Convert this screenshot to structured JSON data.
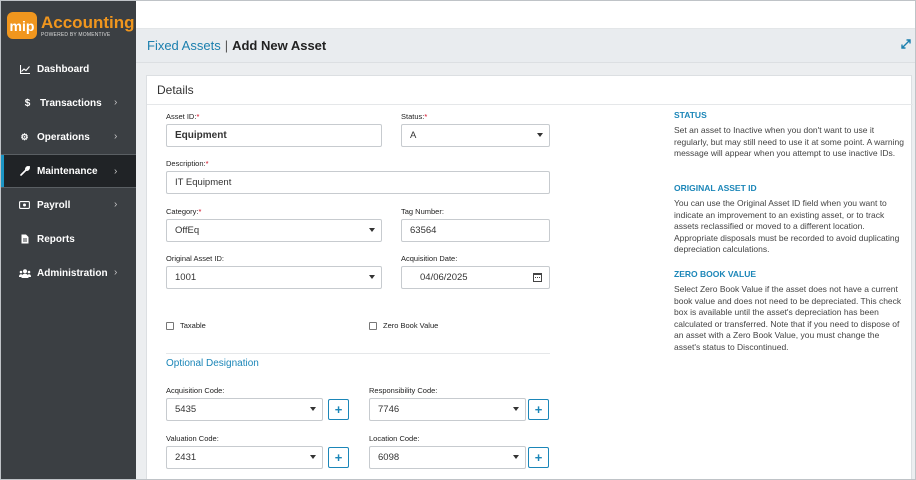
{
  "brand": {
    "badge": "mip",
    "title": "Accounting",
    "subtitle": "POWERED BY MOMENTIVE",
    "accent": "#f0961e"
  },
  "sidebar": {
    "items": [
      {
        "label": "Dashboard",
        "icon": "chart-line-icon",
        "glyph": "╱",
        "chevron": false,
        "active": false
      },
      {
        "label": "Transactions",
        "icon": "dollar-icon",
        "glyph": "$",
        "chevron": true,
        "active": false
      },
      {
        "label": "Operations",
        "icon": "gears-icon",
        "glyph": "⚙",
        "chevron": true,
        "active": false
      },
      {
        "label": "Maintenance",
        "icon": "wrench-icon",
        "glyph": "⚒",
        "chevron": true,
        "active": true
      },
      {
        "label": "Payroll",
        "icon": "money-icon",
        "glyph": "▣",
        "chevron": true,
        "active": false
      },
      {
        "label": "Reports",
        "icon": "file-icon",
        "glyph": "▤",
        "chevron": false,
        "active": false
      },
      {
        "label": "Administration",
        "icon": "users-icon",
        "glyph": "⚇",
        "chevron": true,
        "active": false
      }
    ]
  },
  "breadcrumb": {
    "parent": "Fixed Assets",
    "separator": "|",
    "current": "Add New Asset"
  },
  "form": {
    "title": "Details",
    "asset_id": {
      "label": "Asset ID:",
      "required": "*",
      "value": "Equipment"
    },
    "status": {
      "label": "Status:",
      "required": "*",
      "value": "A"
    },
    "description": {
      "label": "Description:",
      "required": "*",
      "value": "IT Equipment"
    },
    "category": {
      "label": "Category:",
      "required": "*",
      "value": "OffEq"
    },
    "tag_number": {
      "label": "Tag Number:",
      "value": "63564"
    },
    "original_asset_id": {
      "label": "Original Asset ID:",
      "value": "1001"
    },
    "acquisition_date": {
      "label": "Acquisition Date:",
      "value": "04/06/2025"
    },
    "taxable": {
      "label": "Taxable",
      "checked": false
    },
    "zero_book_value": {
      "label": "Zero Book Value",
      "checked": false
    },
    "optional_title": "Optional Designation",
    "acquisition_code": {
      "label": "Acquisition Code:",
      "value": "5435"
    },
    "responsibility_code": {
      "label": "Responsibility Code:",
      "value": "7746"
    },
    "valuation_code": {
      "label": "Valuation Code:",
      "value": "2431"
    },
    "location_code": {
      "label": "Location Code:",
      "value": "6098"
    },
    "add_glyph": "+"
  },
  "help": {
    "status_title": "STATUS",
    "status_text": "Set an asset to Inactive when you don't want to use it regularly, but may still need to use it at some point. A warning message will appear when you attempt to use inactive IDs.",
    "original_title": "ORIGINAL ASSET ID",
    "original_text": "You can use the Original Asset ID field when you want to indicate an improvement to an existing asset, or to track assets reclassified or moved to a different location. Appropriate disposals must be recorded to avoid duplicating depreciation calculations.",
    "zero_title": "ZERO BOOK VALUE",
    "zero_text": "Select Zero Book Value if the asset does not have a current book value and does not need to be depreciated. This check box is available until the asset's depreciation has been calculated or transferred. Note that if you need to dispose of an asset with a Zero Book Value, you must change the asset's status to Discontinued."
  },
  "colors": {
    "sidebar_bg": "#3b3f43",
    "active_bg": "#202326",
    "link": "#1b7fae",
    "required": "#d0021b"
  }
}
